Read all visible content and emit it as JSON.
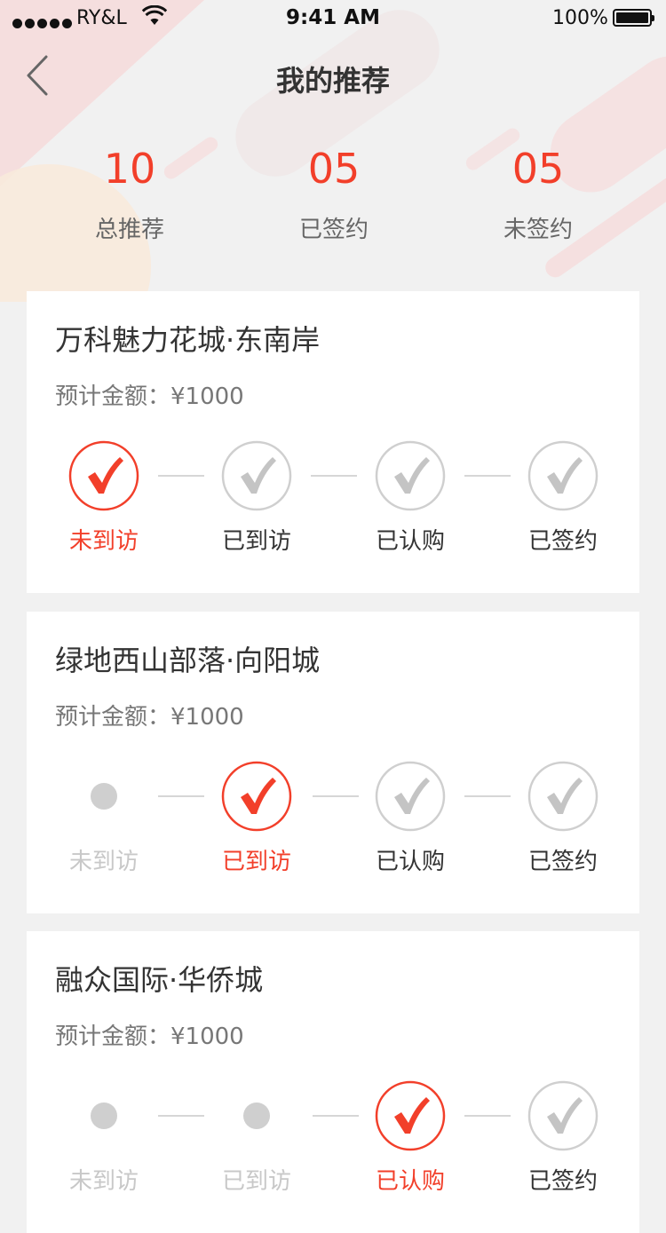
{
  "status_bar": {
    "carrier": "RY&L",
    "time": "9:41 AM",
    "battery": "100%"
  },
  "nav": {
    "title": "我的推荐"
  },
  "stats": [
    {
      "value": "10",
      "label": "总推荐"
    },
    {
      "value": "05",
      "label": "已签约"
    },
    {
      "value": "05",
      "label": "未签约"
    }
  ],
  "colors": {
    "accent": "#f23f2a",
    "inactive": "#cccccc"
  },
  "cards": [
    {
      "name": "万科魅力花城·东南岸",
      "amount": "预计金额：¥1000",
      "steps": [
        {
          "label": "未到访",
          "state": "active"
        },
        {
          "label": "已到访",
          "state": "future"
        },
        {
          "label": "已认购",
          "state": "future"
        },
        {
          "label": "已签约",
          "state": "future"
        }
      ]
    },
    {
      "name": "绿地西山部落·向阳城",
      "amount": "预计金额：¥1000",
      "steps": [
        {
          "label": "未到访",
          "state": "done"
        },
        {
          "label": "已到访",
          "state": "active"
        },
        {
          "label": "已认购",
          "state": "future"
        },
        {
          "label": "已签约",
          "state": "future"
        }
      ]
    },
    {
      "name": "融众国际·华侨城",
      "amount": "预计金额：¥1000",
      "steps": [
        {
          "label": "未到访",
          "state": "done"
        },
        {
          "label": "已到访",
          "state": "done"
        },
        {
          "label": "已认购",
          "state": "active"
        },
        {
          "label": "已签约",
          "state": "future"
        }
      ]
    }
  ]
}
